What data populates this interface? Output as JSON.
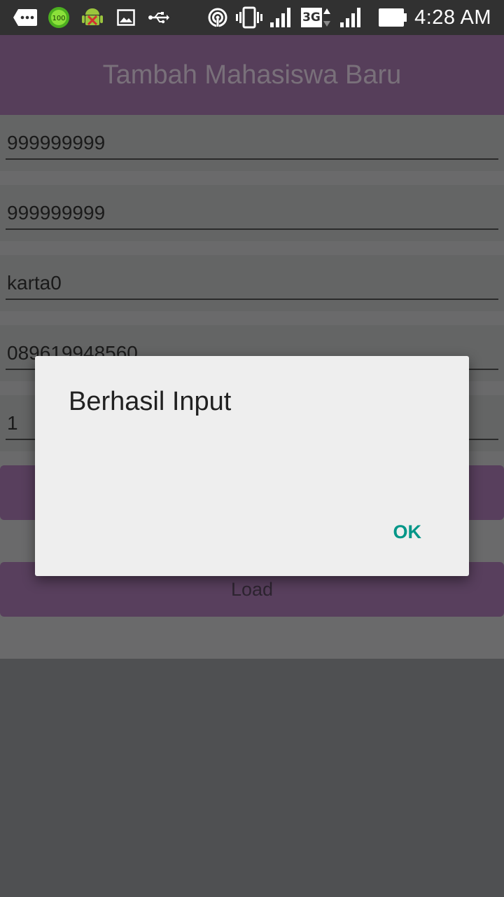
{
  "status_bar": {
    "time": "4:28 AM",
    "battery_badge": "100",
    "network_type": "3G",
    "icons": [
      "message-icon",
      "battery-100-icon",
      "android-debug-icon",
      "image-icon",
      "usb-icon",
      "hotspot-icon",
      "vibrate-icon",
      "signal-icon",
      "3g-icon",
      "signal-icon",
      "battery-icon"
    ]
  },
  "app_bar": {
    "title": "Tambah Mahasiswa Baru"
  },
  "form": {
    "fields": [
      {
        "value": "999999999"
      },
      {
        "value": "999999999"
      },
      {
        "value": "karta0"
      },
      {
        "value": "089619948560"
      },
      {
        "value": "1"
      }
    ],
    "load_button": "Load"
  },
  "dialog": {
    "title": "Berhasil Input",
    "ok_label": "OK"
  },
  "colors": {
    "app_bar": "#563e5a",
    "button": "#583f5d",
    "dialog_accent": "#009688",
    "status_bar": "#313131"
  }
}
